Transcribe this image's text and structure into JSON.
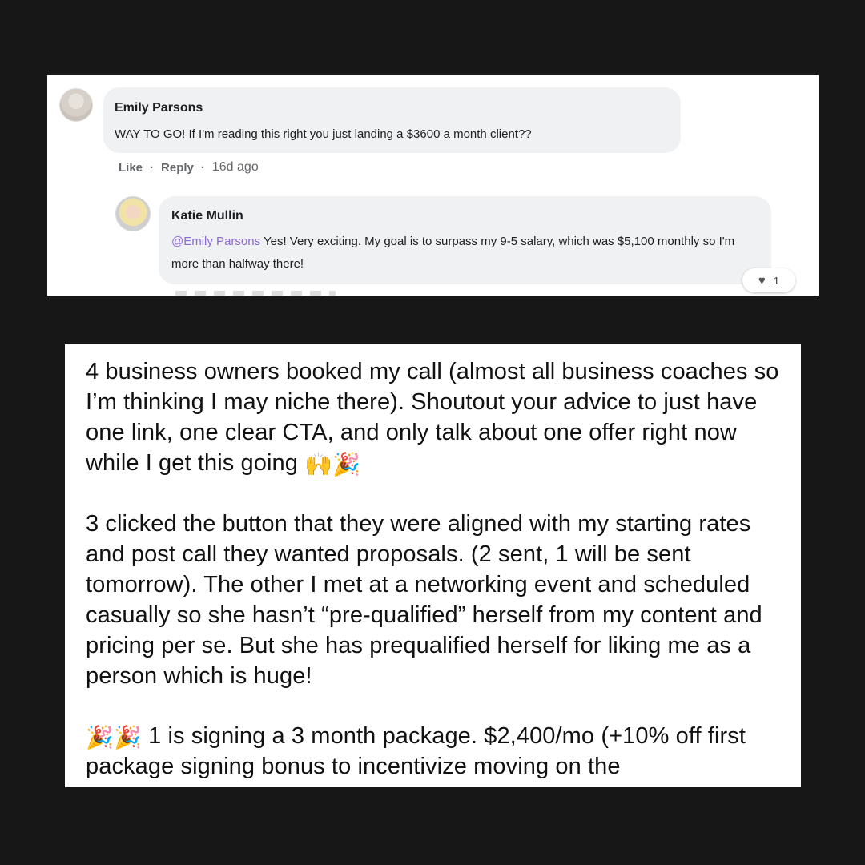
{
  "comment_thread": {
    "comment": {
      "author": "Emily Parsons",
      "text": "WAY TO GO! If I'm reading this right you just landing a $3600 a month client??",
      "actions": {
        "like": "Like",
        "reply": "Reply",
        "separator": "·",
        "timestamp": "16d ago"
      }
    },
    "reply": {
      "author": "Katie Mullin",
      "mention": "@Emily Parsons",
      "text": " Yes! Very exciting. My goal is to surpass my 9-5 salary, which was $5,100 monthly so I'm more than halfway there!",
      "reaction": {
        "icon": "heart-icon",
        "count": "1"
      }
    }
  },
  "notes": {
    "paragraph_1": "4 business owners booked my call (almost all business coaches so I’m thinking I may niche there). Shoutout your advice to just have one link, one clear CTA, and only talk about one offer right now while I get this going",
    "paragraph_1_emojis": "🙌🎉",
    "paragraph_2": "3 clicked the button that they were aligned with my starting rates and post call they wanted proposals. (2 sent, 1 will be sent tomorrow). The other I met at a networking event and scheduled casually so she hasn’t “pre-qualified” herself from my content and pricing per se. But she has prequalified herself for liking me as a person which is huge!",
    "paragraph_3_emojis": "🎉🎉",
    "paragraph_3": " 1 is signing a 3 month package. $2,400/mo (+10% off first package signing bonus to incentivize moving on the"
  },
  "colors": {
    "background": "#171717",
    "bubble": "#f0f1f3",
    "mention": "#8c6ad8",
    "meta_text": "#65676b"
  }
}
